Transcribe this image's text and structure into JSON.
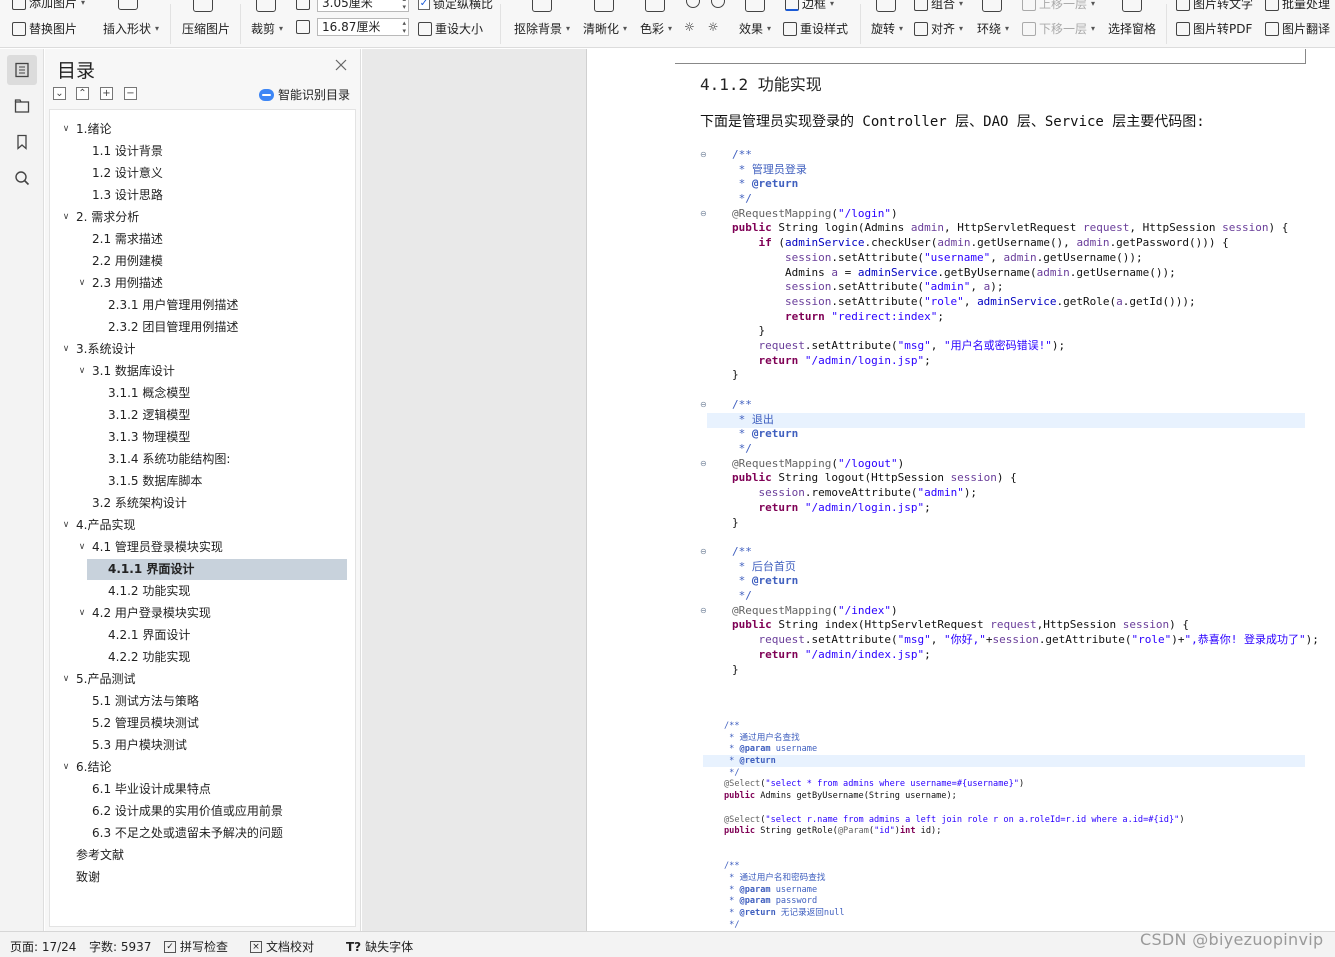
{
  "toolbar": {
    "row1": [
      "添加图片",
      "3.05厘米",
      "锁定纵横比",
      "图片转文字",
      "批量处理"
    ],
    "replace_image": "替换图片",
    "insert_shape": "插入形状",
    "compress_image": "压缩图片",
    "crop": "裁剪",
    "width_value": "3.05厘米",
    "height_value": "16.87厘米",
    "lock_ratio": "锁定纵横比",
    "reset_size": "重设大小",
    "remove_bg": "抠除背景",
    "sharpen": "清晰化",
    "color": "色彩",
    "effects": "效果",
    "reset_style": "重设样式",
    "border": "边框",
    "rotate": "旋转",
    "align": "对齐",
    "wrap": "环绕",
    "group": "组合",
    "bring_forward": "上移一层",
    "send_backward": "下移一层",
    "selection_pane": "选择窗格",
    "to_text": "图片转文字",
    "to_pdf": "图片转PDF",
    "batch": "批量处理",
    "translate": "图片翻译"
  },
  "toc": {
    "title": "目录",
    "smart_detect": "智能识别目录",
    "items": [
      {
        "label": "1.绪论",
        "level": 0,
        "expanded": true
      },
      {
        "label": "1.1 设计背景",
        "level": 1
      },
      {
        "label": "1.2 设计意义",
        "level": 1
      },
      {
        "label": "1.3 设计思路",
        "level": 1
      },
      {
        "label": "2. 需求分析",
        "level": 0,
        "expanded": true
      },
      {
        "label": "2.1  需求描述",
        "level": 1
      },
      {
        "label": "2.2  用例建模",
        "level": 1
      },
      {
        "label": "2.3  用例描述",
        "level": 1,
        "expanded": true
      },
      {
        "label": "2.3.1  用户管理用例描述",
        "level": 2
      },
      {
        "label": "2.3.2  团目管理用例描述",
        "level": 2
      },
      {
        "label": "3.系统设计",
        "level": 0,
        "expanded": true
      },
      {
        "label": "3.1  数据库设计",
        "level": 1,
        "expanded": true
      },
      {
        "label": "3.1.1  概念模型",
        "level": 2
      },
      {
        "label": "3.1.2  逻辑模型",
        "level": 2
      },
      {
        "label": "3.1.3  物理模型",
        "level": 2
      },
      {
        "label": "3.1.4  系统功能结构图:",
        "level": 2
      },
      {
        "label": "3.1.5  数据库脚本",
        "level": 2
      },
      {
        "label": "3.2  系统架构设计",
        "level": 1
      },
      {
        "label": "4.产品实现",
        "level": 0,
        "expanded": true
      },
      {
        "label": "4.1  管理员登录模块实现",
        "level": 1,
        "expanded": true
      },
      {
        "label": "4.1.1  界面设计",
        "level": 2,
        "selected": true
      },
      {
        "label": "4.1.2  功能实现",
        "level": 2
      },
      {
        "label": "4.2  用户登录模块实现",
        "level": 1,
        "expanded": true
      },
      {
        "label": "4.2.1  界面设计",
        "level": 2
      },
      {
        "label": "4.2.2  功能实现",
        "level": 2
      },
      {
        "label": "5.产品测试",
        "level": 0,
        "expanded": true
      },
      {
        "label": "5.1  测试方法与策略",
        "level": 1
      },
      {
        "label": "5.2 管理员模块测试",
        "level": 1
      },
      {
        "label": "5.3  用户模块测试",
        "level": 1
      },
      {
        "label": "6.结论",
        "level": 0,
        "expanded": true
      },
      {
        "label": "6.1  毕业设计成果特点",
        "level": 1
      },
      {
        "label": "6.2 设计成果的实用价值或应用前景",
        "level": 1
      },
      {
        "label": "6.3 不足之处或遗留未予解决的问题",
        "level": 1
      },
      {
        "label": "参考文献",
        "level": 0
      },
      {
        "label": "致谢",
        "level": 0
      }
    ]
  },
  "document": {
    "heading": "4.1.2  功能实现",
    "paragraph": "下面是管理员实现登录的 Controller 层、DAO 层、Service 层主要代码图:",
    "code_login": [
      "/**",
      " * 管理员登录",
      " * @return",
      " */",
      "@RequestMapping(\"/login\")",
      "public String login(Admins admin, HttpServletRequest request, HttpSession session) {",
      "    if (adminService.checkUser(admin.getUsername(), admin.getPassword())) {",
      "        session.setAttribute(\"username\", admin.getUsername());",
      "        Admins a = adminService.getByUsername(admin.getUsername());",
      "        session.setAttribute(\"admin\", a);",
      "        session.setAttribute(\"role\", adminService.getRole(a.getId()));",
      "        return \"redirect:index\";",
      "    }",
      "    request.setAttribute(\"msg\", \"用户名或密码错误!\");",
      "    return \"/admin/login.jsp\";",
      "}"
    ],
    "code_logout": [
      "/**",
      " * 退出",
      " * @return",
      " */",
      "@RequestMapping(\"/logout\")",
      "public String logout(HttpSession session) {",
      "    session.removeAttribute(\"admin\");",
      "    return \"/admin/login.jsp\";",
      "}"
    ],
    "code_index": [
      "/**",
      " * 后台首页",
      " * @return",
      " */",
      "@RequestMapping(\"/index\")",
      "public String index(HttpServletRequest request,HttpSession session) {",
      "    request.setAttribute(\"msg\", \"你好,\"+session.getAttribute(\"role\")+\",恭喜你! 登录成功了\");",
      "    return \"/admin/index.jsp\";",
      "}"
    ],
    "code_dao": [
      "/**",
      " * 通过用户名查找",
      " * @param username",
      " * @return",
      " */",
      "@Select(\"select * from admins where username=#{username}\")",
      "public Admins getByUsername(String username);",
      "",
      "@Select(\"select r.name from admins a left join role r on a.roleId=r.id where a.id=#{id}\")",
      "public String getRole(@Param(\"id\")int id);",
      "",
      "",
      "/**",
      " * 通过用户名和密码查找",
      " * @param username",
      " * @param password",
      " * @return 无记录返回null",
      " */"
    ]
  },
  "status": {
    "page": "页面: 17/24",
    "words": "字数: 5937",
    "spell": "拼写检查",
    "proof": "文档校对",
    "missing_font": "缺失字体"
  },
  "watermark": "CSDN @biyezuopinvip"
}
